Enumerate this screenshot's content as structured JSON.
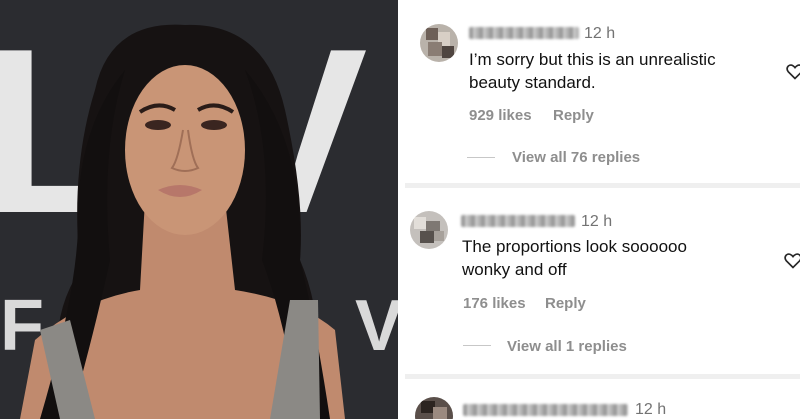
{
  "photo": {
    "backdrop_letters": [
      "LIV",
      "F",
      "V"
    ],
    "colors": {
      "backdrop": "#2a2b2f",
      "letters": "#e8e8e8",
      "hair": "#141111",
      "skin": "#c89478",
      "dress": "#8c8a86"
    }
  },
  "comments": [
    {
      "time": "12 h",
      "text_lines": [
        "I’m sorry but this is an unrealistic",
        "beauty standard."
      ],
      "likes": "929 likes",
      "reply": "Reply",
      "view_all": "View all 76 replies"
    },
    {
      "time": "12 h",
      "text_lines": [
        "The proportions look soooooo",
        "wonky and off"
      ],
      "likes": "176 likes",
      "reply": "Reply",
      "view_all": "View all 1 replies"
    },
    {
      "time": "12 h"
    }
  ],
  "icons": {
    "like": "heart-outline-icon"
  }
}
